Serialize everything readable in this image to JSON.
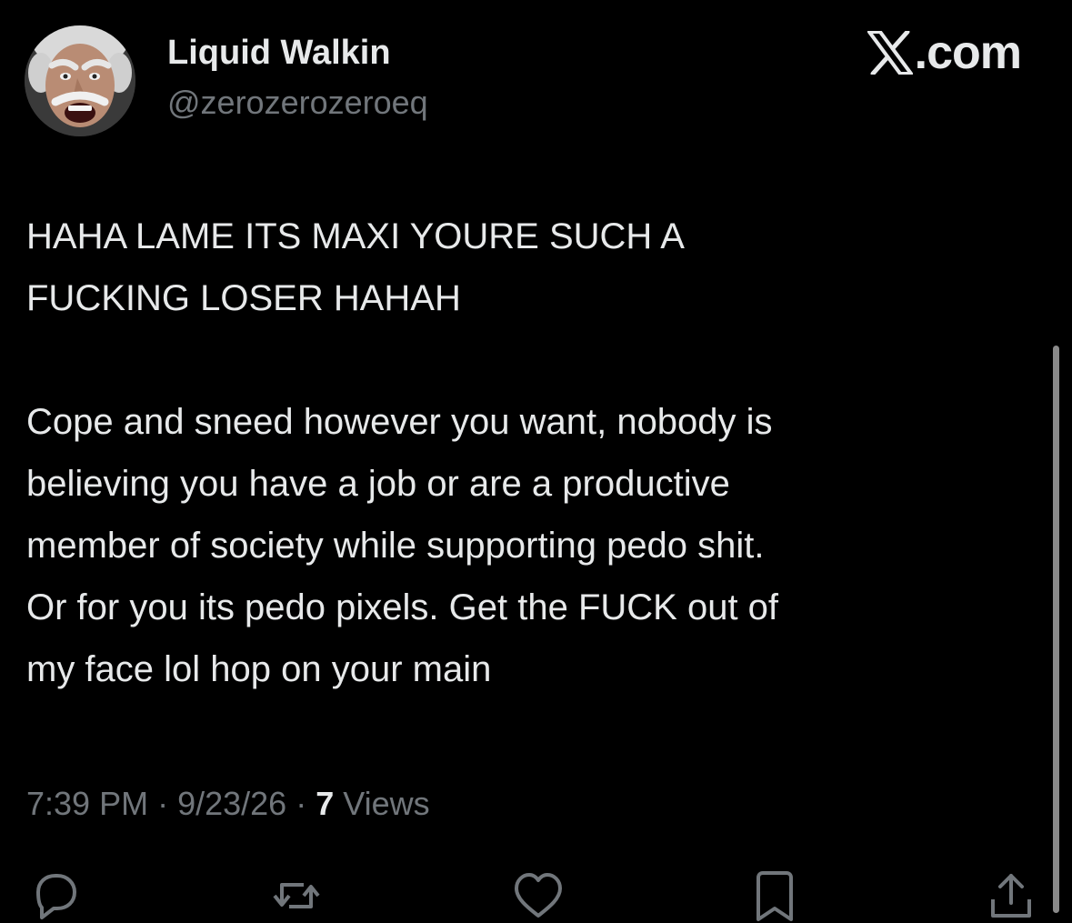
{
  "author": {
    "display_name": "Liquid Walkin",
    "handle": "@zerozerozeroeq",
    "avatar_icon": "avatar-cartoon-face-icon"
  },
  "brand": {
    "logo_icon": "x-logo-icon",
    "suffix": ".com"
  },
  "tweet": {
    "paragraph_1": "HAHA LAME ITS MAXI YOURE SUCH A\nFUCKING LOSER HAHAH",
    "paragraph_2": "Cope and sneed however you want, nobody is\nbelieving you have a job or are a productive\nmember of society while supporting pedo shit.\nOr for you its pedo pixels. Get the FUCK out of\nmy face lol hop on your main"
  },
  "meta": {
    "time": "7:39 PM",
    "separator": " · ",
    "date": "9/23/26",
    "views_count": "7",
    "views_label": " Views"
  },
  "actions": [
    {
      "name": "reply",
      "icon": "reply-icon"
    },
    {
      "name": "retweet",
      "icon": "retweet-icon"
    },
    {
      "name": "like",
      "icon": "heart-icon"
    },
    {
      "name": "bookmark",
      "icon": "bookmark-icon"
    },
    {
      "name": "share",
      "icon": "share-icon"
    }
  ],
  "colors": {
    "background": "#000000",
    "primary_text": "#e7e9ea",
    "secondary_text": "#71767b",
    "scrollbar": "#8a8a8a"
  }
}
